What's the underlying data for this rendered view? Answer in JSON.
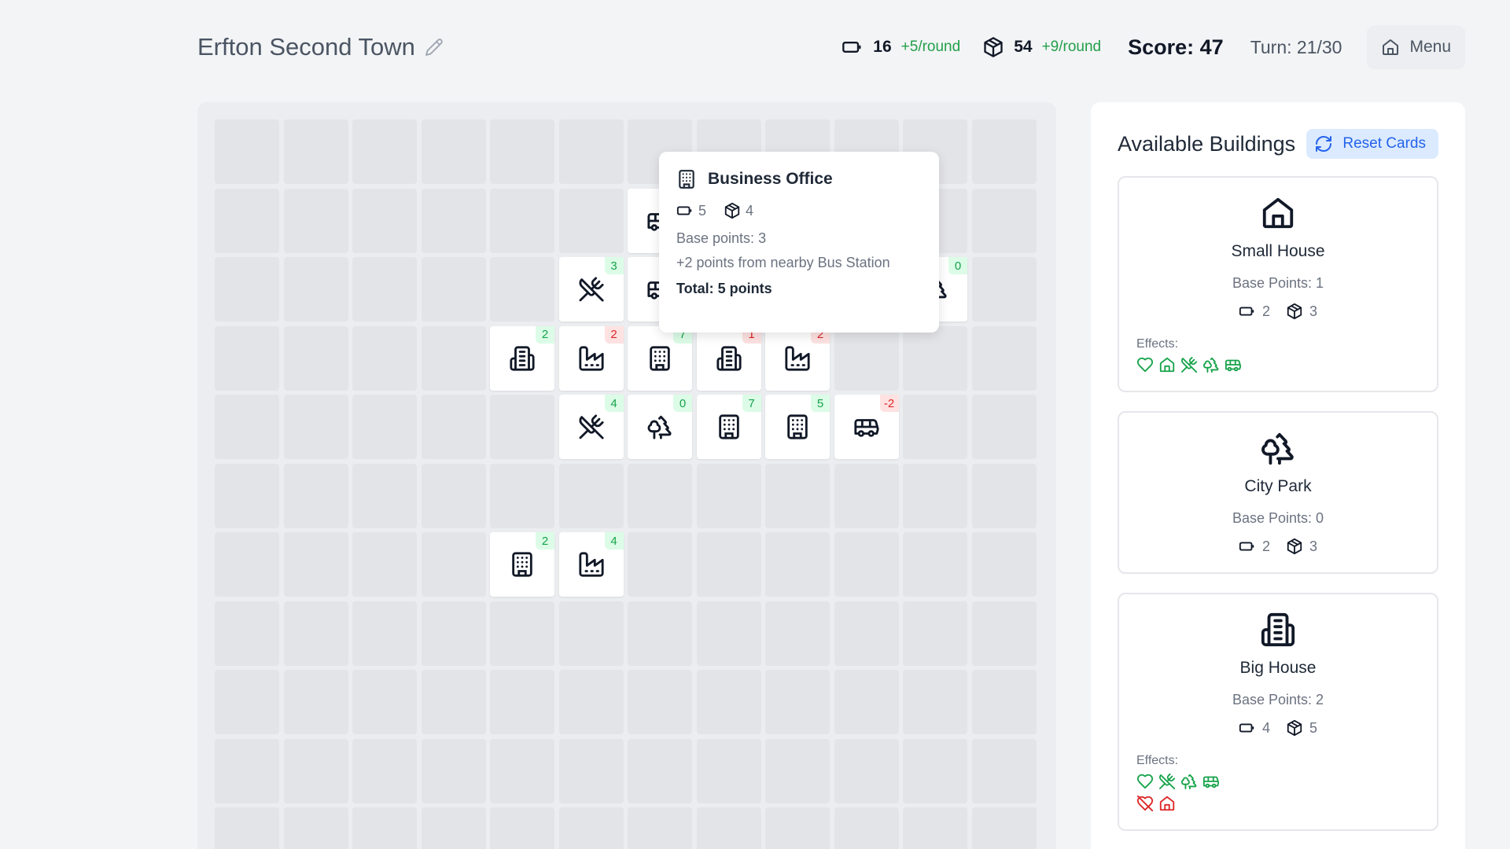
{
  "header": {
    "town_name": "Erfton Second Town",
    "money": {
      "icon": "money-icon",
      "value": "16",
      "rate": "+5/round"
    },
    "materials": {
      "icon": "materials-icon",
      "value": "54",
      "rate": "+9/round"
    },
    "score": "Score: 47",
    "turn": "Turn: 21/30",
    "menu_label": "Menu"
  },
  "board": {
    "columns": 12,
    "rows": 11,
    "buildings": [
      {
        "row": 1,
        "col": 6,
        "type": "bus-station",
        "badge": ""
      },
      {
        "row": 2,
        "col": 5,
        "type": "restaurant",
        "badge": "3"
      },
      {
        "row": 2,
        "col": 6,
        "type": "bus-station",
        "badge": ""
      },
      {
        "row": 2,
        "col": 10,
        "type": "park",
        "badge": "0"
      },
      {
        "row": 3,
        "col": 4,
        "type": "big-house",
        "badge": "2"
      },
      {
        "row": 3,
        "col": 5,
        "type": "factory",
        "badge": "2",
        "negative": true
      },
      {
        "row": 3,
        "col": 6,
        "type": "office",
        "badge": "7"
      },
      {
        "row": 3,
        "col": 7,
        "type": "big-house",
        "badge": "1",
        "negative": true
      },
      {
        "row": 3,
        "col": 8,
        "type": "factory",
        "badge": "2",
        "negative": true
      },
      {
        "row": 4,
        "col": 5,
        "type": "restaurant",
        "badge": "4"
      },
      {
        "row": 4,
        "col": 6,
        "type": "park",
        "badge": "0"
      },
      {
        "row": 4,
        "col": 7,
        "type": "office",
        "badge": "7"
      },
      {
        "row": 4,
        "col": 8,
        "type": "office",
        "badge": "5"
      },
      {
        "row": 4,
        "col": 9,
        "type": "bus-station",
        "badge": "-2"
      },
      {
        "row": 6,
        "col": 4,
        "type": "office",
        "badge": "2"
      },
      {
        "row": 6,
        "col": 5,
        "type": "factory",
        "badge": "4"
      }
    ]
  },
  "tooltip": {
    "icon": "office-icon",
    "title": "Business Office",
    "money_cost": "5",
    "materials_cost": "4",
    "base_points": "Base points: 3",
    "bonus": "+2 points from nearby Bus Station",
    "total": "Total: 5 points"
  },
  "panel": {
    "title": "Available Buildings",
    "reset_label": "Reset Cards",
    "effects_label": "Effects:",
    "cards": [
      {
        "icon": "house-icon",
        "name": "Small House",
        "base_points": "Base Points: 1",
        "money_cost": "2",
        "materials_cost": "3",
        "effects_pos": [
          "heart-icon",
          "house-icon",
          "restaurant-icon",
          "park-icon",
          "bus-icon"
        ],
        "effects_neg": []
      },
      {
        "icon": "park-icon",
        "name": "City Park",
        "base_points": "Base Points: 0",
        "money_cost": "2",
        "materials_cost": "3",
        "effects_pos": [],
        "effects_neg": []
      },
      {
        "icon": "big-house-icon",
        "name": "Big House",
        "base_points": "Base Points: 2",
        "money_cost": "4",
        "materials_cost": "5",
        "effects_pos": [
          "heart-icon",
          "restaurant-icon",
          "park-icon",
          "bus-icon"
        ],
        "effects_neg": [
          "heart-off-icon",
          "house-icon"
        ]
      }
    ]
  },
  "colors": {
    "positive": "#16a34a",
    "negative": "#dc2626",
    "accent": "#2563eb"
  }
}
